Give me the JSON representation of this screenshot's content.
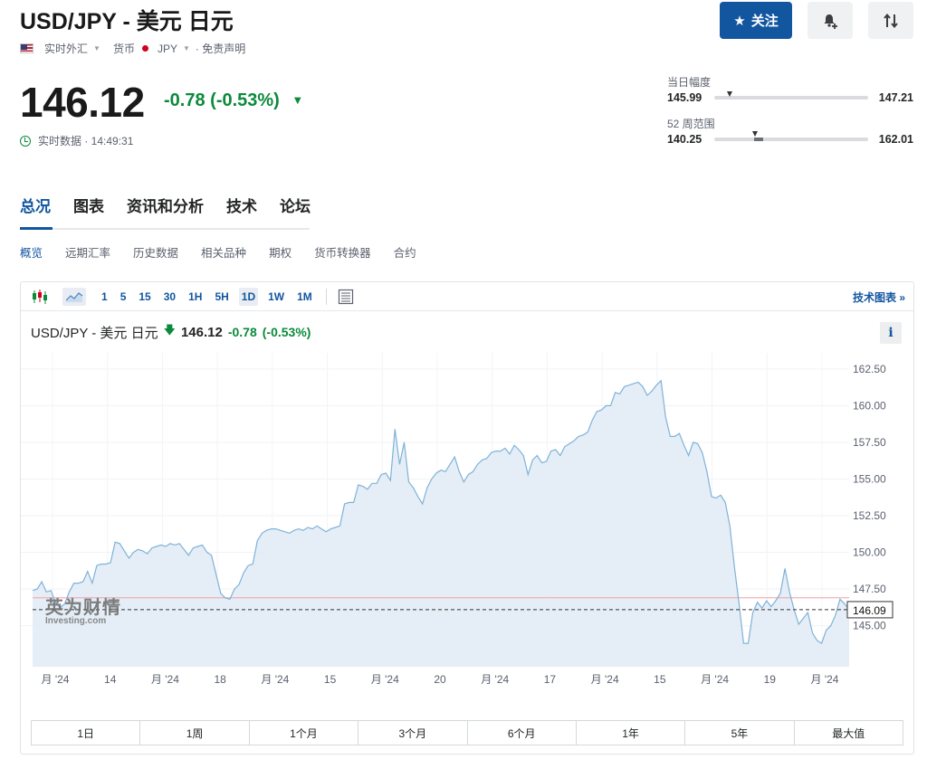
{
  "header": {
    "title": "USD/JPY - 美元 日元",
    "meta_type": "实时外汇",
    "meta_asset": "货币",
    "meta_currency": "JPY",
    "meta_disclaimer": "· 免责声明",
    "follow_label": "关注"
  },
  "quote": {
    "price": "146.12",
    "change": "-0.78",
    "change_pct": "(-0.53%)",
    "realtime_label": "实时数据 · 14:49:31"
  },
  "ranges_info": {
    "day_label": "当日幅度",
    "day_low": "145.99",
    "day_high": "147.21",
    "day_position": 0.1,
    "week52_label": "52 周范围",
    "week52_low": "140.25",
    "week52_high": "162.01",
    "week52_position": 0.27
  },
  "tabs": [
    "总况",
    "图表",
    "资讯和分析",
    "技术",
    "论坛"
  ],
  "subtabs": [
    "概览",
    "远期汇率",
    "历史数据",
    "相关品种",
    "期权",
    "货币转换器",
    "合约"
  ],
  "toolbar": {
    "intervals": [
      "1",
      "5",
      "15",
      "30",
      "1H",
      "5H",
      "1D",
      "1W",
      "1M"
    ],
    "active_interval": "1D",
    "tech_chart_link": "技术图表 »"
  },
  "chart_header": {
    "name": "USD/JPY - 美元 日元",
    "price": "146.12",
    "change": "-0.78",
    "change_pct": "(-0.53%)"
  },
  "watermark": {
    "cn": "英为财情",
    "en": "Investing.com"
  },
  "range_buttons": [
    "1日",
    "1周",
    "1个月",
    "3个月",
    "6个月",
    "1年",
    "5年",
    "最大值"
  ],
  "colors": {
    "accent": "#1256a0",
    "down_green": "#0b8a3b",
    "line": "#7fb2d9",
    "fill": "#e2ecf5",
    "ref_line": "#f2a0a5"
  },
  "chart_data": {
    "type": "area",
    "x_tick_labels": [
      "月 '24",
      "14",
      "月 '24",
      "18",
      "月 '24",
      "15",
      "月 '24",
      "20",
      "月 '24",
      "17",
      "月 '24",
      "15",
      "月 '24",
      "19",
      "月 '24"
    ],
    "y_ticks": [
      145.0,
      147.5,
      150.0,
      152.5,
      155.0,
      157.5,
      160.0,
      162.5
    ],
    "ylim": [
      142.2,
      163.6
    ],
    "last_price_label": "146.09",
    "last_price": 146.09,
    "reference_level": 146.9,
    "grid": true,
    "values": [
      147.4,
      147.5,
      148.0,
      147.3,
      147.4,
      146.6,
      146.2,
      146.5,
      147.3,
      147.9,
      147.9,
      148.0,
      148.7,
      147.9,
      149.1,
      149.2,
      149.2,
      149.3,
      150.7,
      150.6,
      150.1,
      149.6,
      150.0,
      150.2,
      150.1,
      149.9,
      150.3,
      150.4,
      150.5,
      150.4,
      150.6,
      150.5,
      150.6,
      150.2,
      149.8,
      150.3,
      150.4,
      150.5,
      150.0,
      149.8,
      148.5,
      147.2,
      146.9,
      146.8,
      147.5,
      147.8,
      148.6,
      149.1,
      149.2,
      150.8,
      151.3,
      151.5,
      151.6,
      151.6,
      151.5,
      151.4,
      151.3,
      151.5,
      151.6,
      151.5,
      151.7,
      151.6,
      151.8,
      151.6,
      151.4,
      151.6,
      151.7,
      151.8,
      153.3,
      153.4,
      153.4,
      154.6,
      154.5,
      154.3,
      154.7,
      154.7,
      155.3,
      155.4,
      154.9,
      158.4,
      156.0,
      157.5,
      154.8,
      154.4,
      153.8,
      153.3,
      154.4,
      155.0,
      155.4,
      155.6,
      155.5,
      156.0,
      156.5,
      155.5,
      154.8,
      155.3,
      155.5,
      156.0,
      156.3,
      156.4,
      156.8,
      156.9,
      156.9,
      157.1,
      156.7,
      157.3,
      157.0,
      156.6,
      155.3,
      156.3,
      156.6,
      156.1,
      156.2,
      156.9,
      157.0,
      156.6,
      157.2,
      157.4,
      157.6,
      157.9,
      158.0,
      158.2,
      159.0,
      159.6,
      159.7,
      160.0,
      160.0,
      160.9,
      160.8,
      161.3,
      161.4,
      161.5,
      161.6,
      161.3,
      160.7,
      161.0,
      161.4,
      161.7,
      159.2,
      157.9,
      157.9,
      158.1,
      157.3,
      156.6,
      157.5,
      157.4,
      156.8,
      155.5,
      153.8,
      153.7,
      153.9,
      153.4,
      151.8,
      149.0,
      146.5,
      143.8,
      143.8,
      145.9,
      146.6,
      146.2,
      146.7,
      146.3,
      146.7,
      147.2,
      148.9,
      147.3,
      146.1,
      145.1,
      145.5,
      145.9,
      144.5,
      144.0,
      143.8,
      144.7,
      145.0,
      145.7,
      146.8,
      146.5,
      146.1
    ]
  }
}
